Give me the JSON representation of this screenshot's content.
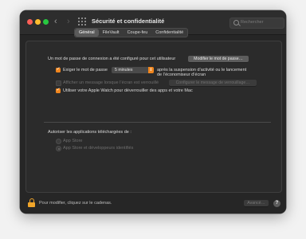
{
  "window": {
    "title": "Sécurité et confidentialité",
    "search_placeholder": "Rechercher"
  },
  "tabs": [
    {
      "label": "Général",
      "active": true
    },
    {
      "label": "FileVault",
      "active": false
    },
    {
      "label": "Coupe-feu",
      "active": false
    },
    {
      "label": "Confidentialité",
      "active": false
    }
  ],
  "general": {
    "password_set_text": "Un mot de passe de connexion a été configuré pour cet utilisateur",
    "change_password_button": "Modifier le mot de passe…",
    "require_password": {
      "checked": true,
      "label": "Exiger le mot de passe",
      "delay_value": "5 minutes",
      "after_line1": "après la suspension d’activité ou le lancement",
      "after_line2": "de l’économiseur d’écran"
    },
    "show_message": {
      "checked": false,
      "enabled": false,
      "label": "Afficher un message lorsque l’écran est verrouillé",
      "button": "Configurer le message de verrouillage…"
    },
    "apple_watch": {
      "checked": true,
      "label": "Utiliser votre Apple Watch pour déverrouiller des apps et votre Mac"
    },
    "downloads": {
      "label": "Autoriser les applications téléchargées de :",
      "options": [
        {
          "label": "App Store",
          "selected": false
        },
        {
          "label": "App Store et développeurs identifiés",
          "selected": true
        }
      ]
    }
  },
  "footer": {
    "lock_text": "Pour modifier, cliquez sur le cadenas.",
    "advanced_button": "Avancé…",
    "help": "?"
  },
  "colors": {
    "accent": "#f0861e",
    "lock": "#f0a52a"
  }
}
